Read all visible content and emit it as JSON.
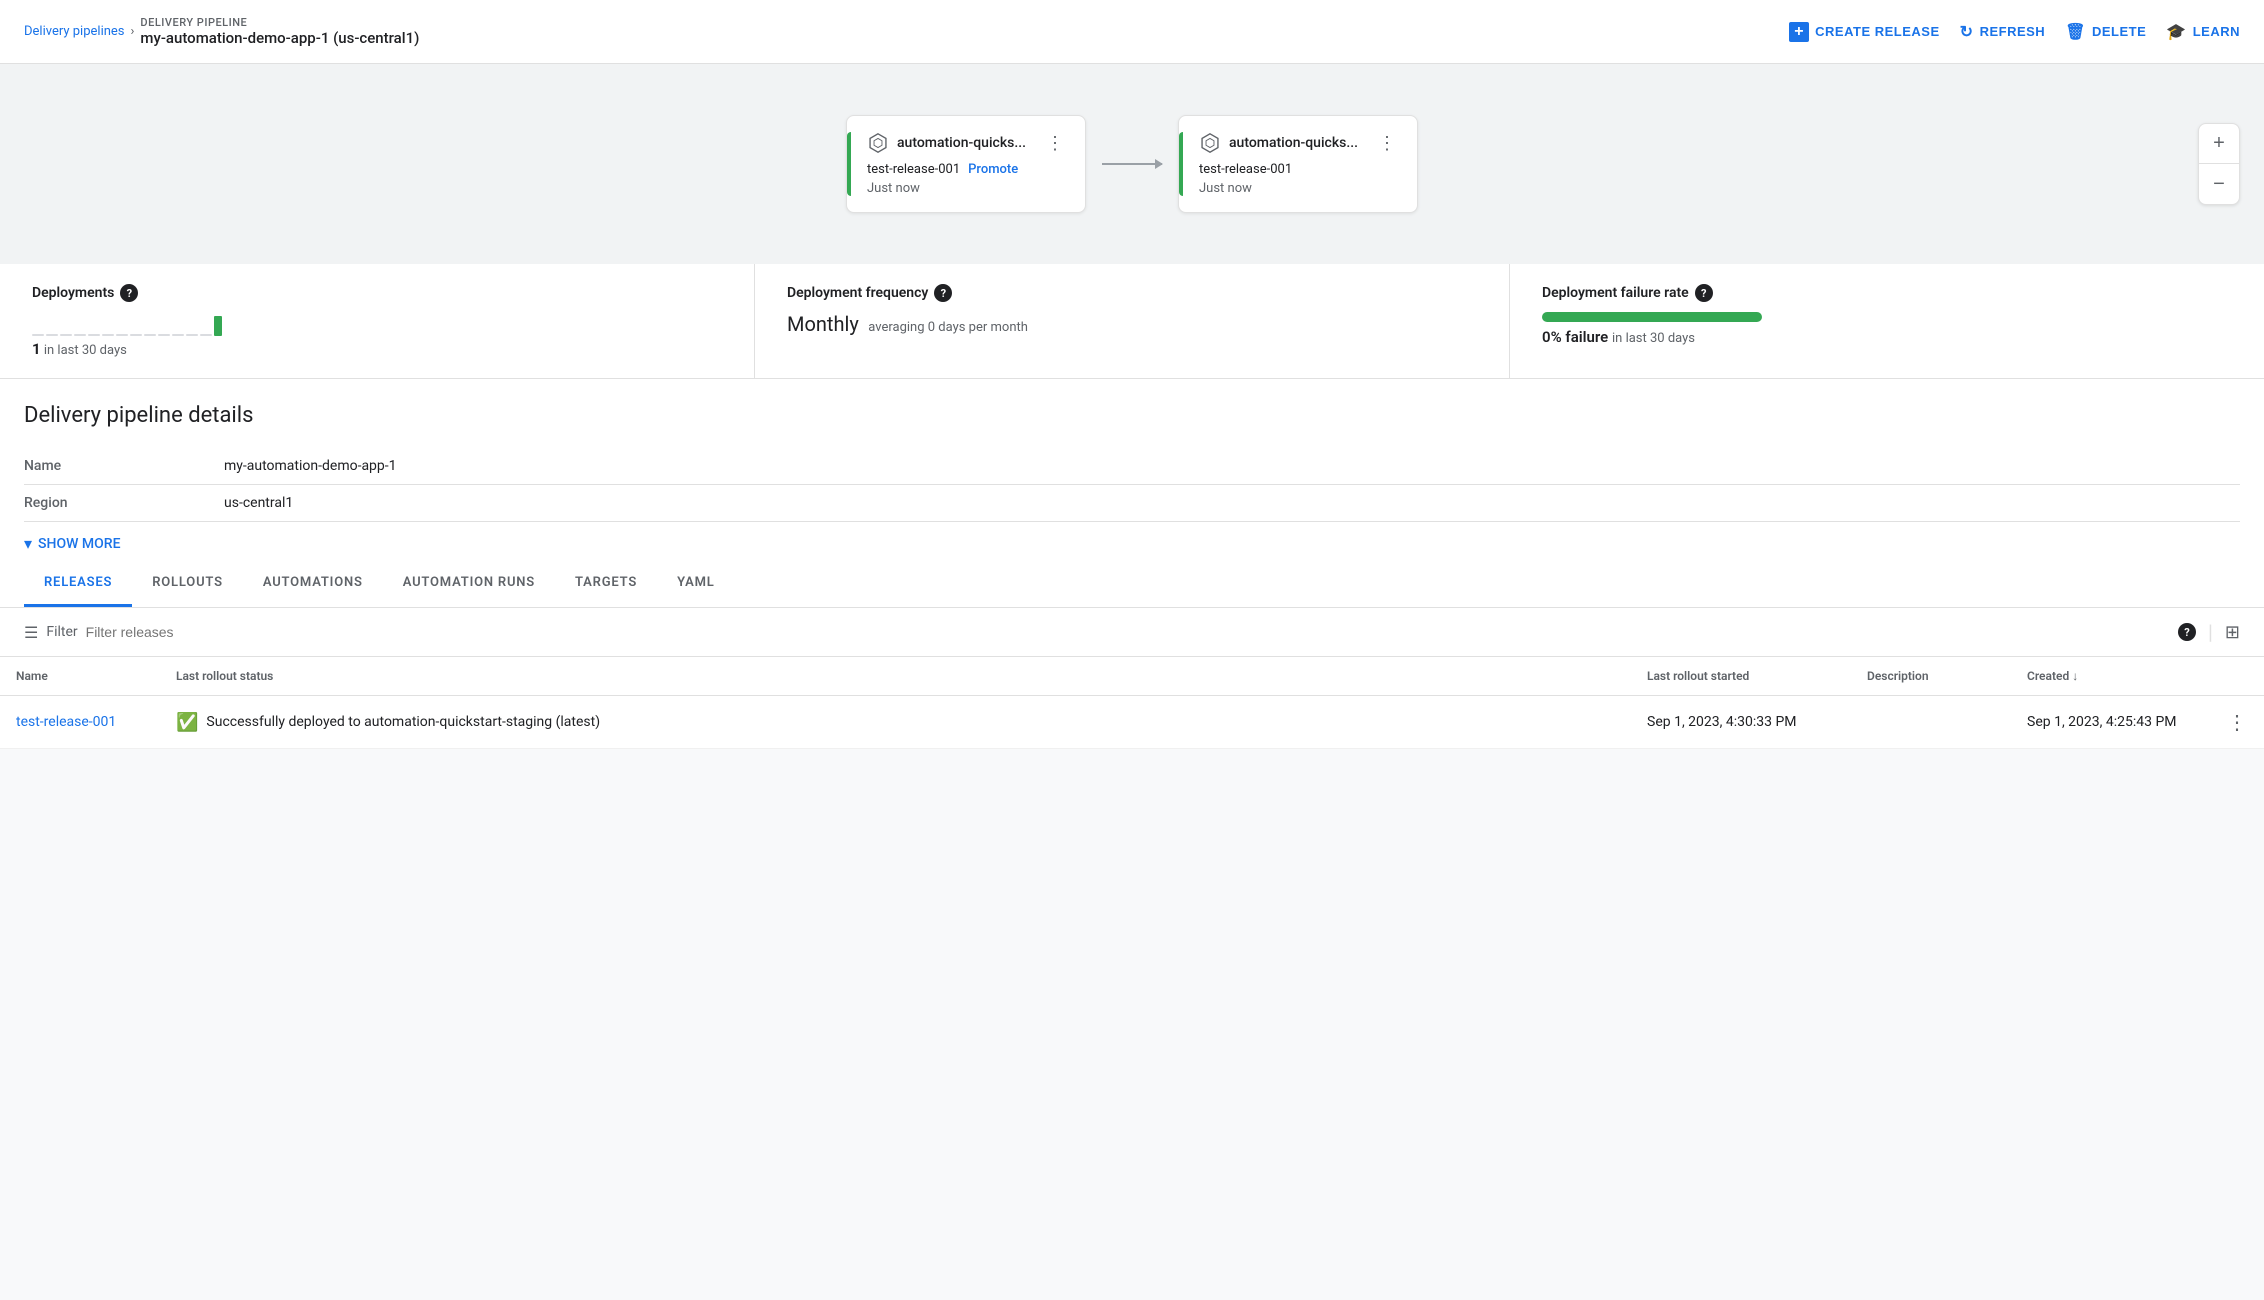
{
  "header": {
    "breadcrumb_link": "Delivery pipelines",
    "chevron": "›",
    "pipeline_name": "DELIVERY PIPELINE",
    "pipeline_sub": "my-automation-demo-app-1 (us-central1)",
    "create_release": "CREATE RELEASE",
    "refresh": "REFRESH",
    "delete": "DELETE",
    "learn": "LEARN"
  },
  "pipeline": {
    "node1": {
      "title": "automation-quicks...",
      "release": "test-release-001",
      "promote_label": "Promote",
      "time": "Just now"
    },
    "node2": {
      "title": "automation-quicks...",
      "release": "test-release-001",
      "time": "Just now"
    },
    "zoom_plus": "+",
    "zoom_minus": "−"
  },
  "metrics": {
    "deployments_label": "Deployments",
    "deployments_count": "1",
    "deployments_period": "in last 30 days",
    "frequency_label": "Deployment frequency",
    "frequency_value": "Monthly",
    "frequency_sub": "averaging 0 days per month",
    "failure_label": "Deployment failure rate",
    "failure_percent": "0%",
    "failure_suffix": "failure",
    "failure_period": "in last 30 days"
  },
  "details": {
    "section_title": "Delivery pipeline details",
    "fields": [
      {
        "label": "Name",
        "value": "my-automation-demo-app-1"
      },
      {
        "label": "Region",
        "value": "us-central1"
      }
    ],
    "show_more": "SHOW MORE"
  },
  "tabs": [
    {
      "id": "releases",
      "label": "RELEASES",
      "active": true
    },
    {
      "id": "rollouts",
      "label": "ROLLOUTS",
      "active": false
    },
    {
      "id": "automations",
      "label": "AUTOMATIONS",
      "active": false
    },
    {
      "id": "automation-runs",
      "label": "AUTOMATION RUNS",
      "active": false
    },
    {
      "id": "targets",
      "label": "TARGETS",
      "active": false
    },
    {
      "id": "yaml",
      "label": "YAML",
      "active": false
    }
  ],
  "filter": {
    "label": "Filter",
    "placeholder": "Filter releases"
  },
  "table": {
    "columns": [
      {
        "id": "name",
        "label": "Name"
      },
      {
        "id": "status",
        "label": "Last rollout status"
      },
      {
        "id": "started",
        "label": "Last rollout started"
      },
      {
        "id": "description",
        "label": "Description"
      },
      {
        "id": "created",
        "label": "Created",
        "sort": "desc"
      }
    ],
    "rows": [
      {
        "name": "test-release-001",
        "status": "Successfully deployed to automation-quickstart-staging (latest)",
        "started": "Sep 1, 2023, 4:30:33 PM",
        "description": "",
        "created": "Sep 1, 2023, 4:25:43 PM"
      }
    ]
  }
}
